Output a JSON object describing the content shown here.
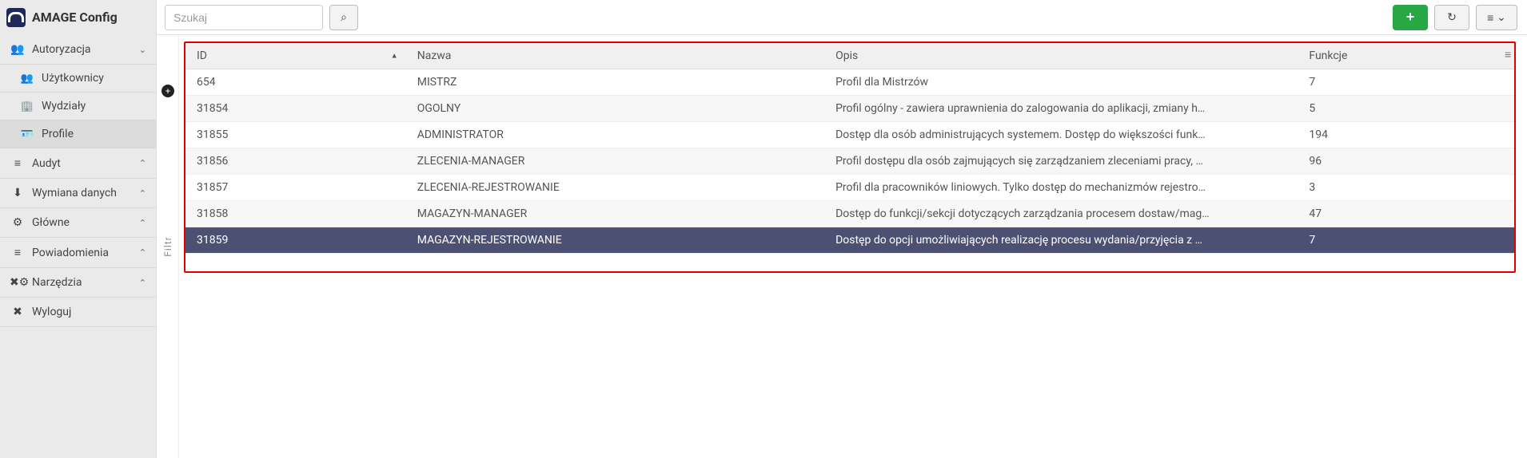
{
  "brand": {
    "title": "AMAGE Config"
  },
  "search": {
    "placeholder": "Szukaj"
  },
  "sidebar": {
    "groups": [
      {
        "icon": "👥",
        "label": "Autoryzacja",
        "expanded": true,
        "chev": "down",
        "subs": [
          {
            "icon": "👥",
            "label": "Użytkownicy"
          },
          {
            "icon": "🏢",
            "label": "Wydziały"
          },
          {
            "icon": "🪪",
            "label": "Profile",
            "active": true
          }
        ]
      },
      {
        "icon": "≡",
        "label": "Audyt",
        "chev": "up"
      },
      {
        "icon": "⬇",
        "label": "Wymiana danych",
        "chev": "up"
      },
      {
        "icon": "⚙",
        "label": "Główne",
        "chev": "up"
      },
      {
        "icon": "≡",
        "label": "Powiadomienia",
        "chev": "up"
      },
      {
        "icon": "✖⚙",
        "label": "Narzędzia",
        "chev": "up"
      },
      {
        "icon": "✖",
        "label": "Wyloguj",
        "chev": ""
      }
    ]
  },
  "filter_rail": {
    "label": "Filtr"
  },
  "table": {
    "headers": {
      "id": "ID",
      "name": "Nazwa",
      "desc": "Opis",
      "func": "Funkcje",
      "sort_col": "id",
      "sort_dir": "asc"
    },
    "rows": [
      {
        "id": "654",
        "name": "MISTRZ",
        "desc": "Profil dla Mistrzów",
        "func": "7",
        "selected": false
      },
      {
        "id": "31854",
        "name": "OGOLNY",
        "desc": "Profil ogólny - zawiera uprawnienia do zalogowania do aplikacji, zmiany h…",
        "func": "5",
        "selected": false
      },
      {
        "id": "31855",
        "name": "ADMINISTRATOR",
        "desc": "Dostęp dla osób administrujących systemem. Dostęp do większości funk…",
        "func": "194",
        "selected": false
      },
      {
        "id": "31856",
        "name": "ZLECENIA-MANAGER",
        "desc": "Profil dostępu dla osób zajmujących się zarządzaniem zleceniami pracy, …",
        "func": "96",
        "selected": false
      },
      {
        "id": "31857",
        "name": "ZLECENIA-REJESTROWANIE",
        "desc": "Profil dla pracowników liniowych. Tylko dostęp do mechanizmów rejestro…",
        "func": "3",
        "selected": false
      },
      {
        "id": "31858",
        "name": "MAGAZYN-MANAGER",
        "desc": "Dostęp do funkcji/sekcji dotyczących zarządzania procesem dostaw/mag…",
        "func": "47",
        "selected": false
      },
      {
        "id": "31859",
        "name": "MAGAZYN-REJESTROWANIE",
        "desc": "Dostęp do opcji umożliwiających realizację procesu wydania/przyjęcia z …",
        "func": "7",
        "selected": true
      }
    ]
  },
  "icons": {
    "search": "⌕",
    "add": "+",
    "refresh": "↻",
    "menu": "≡",
    "menu_chev": "⌄",
    "sort_asc": "▲",
    "grid_menu": "≡"
  }
}
